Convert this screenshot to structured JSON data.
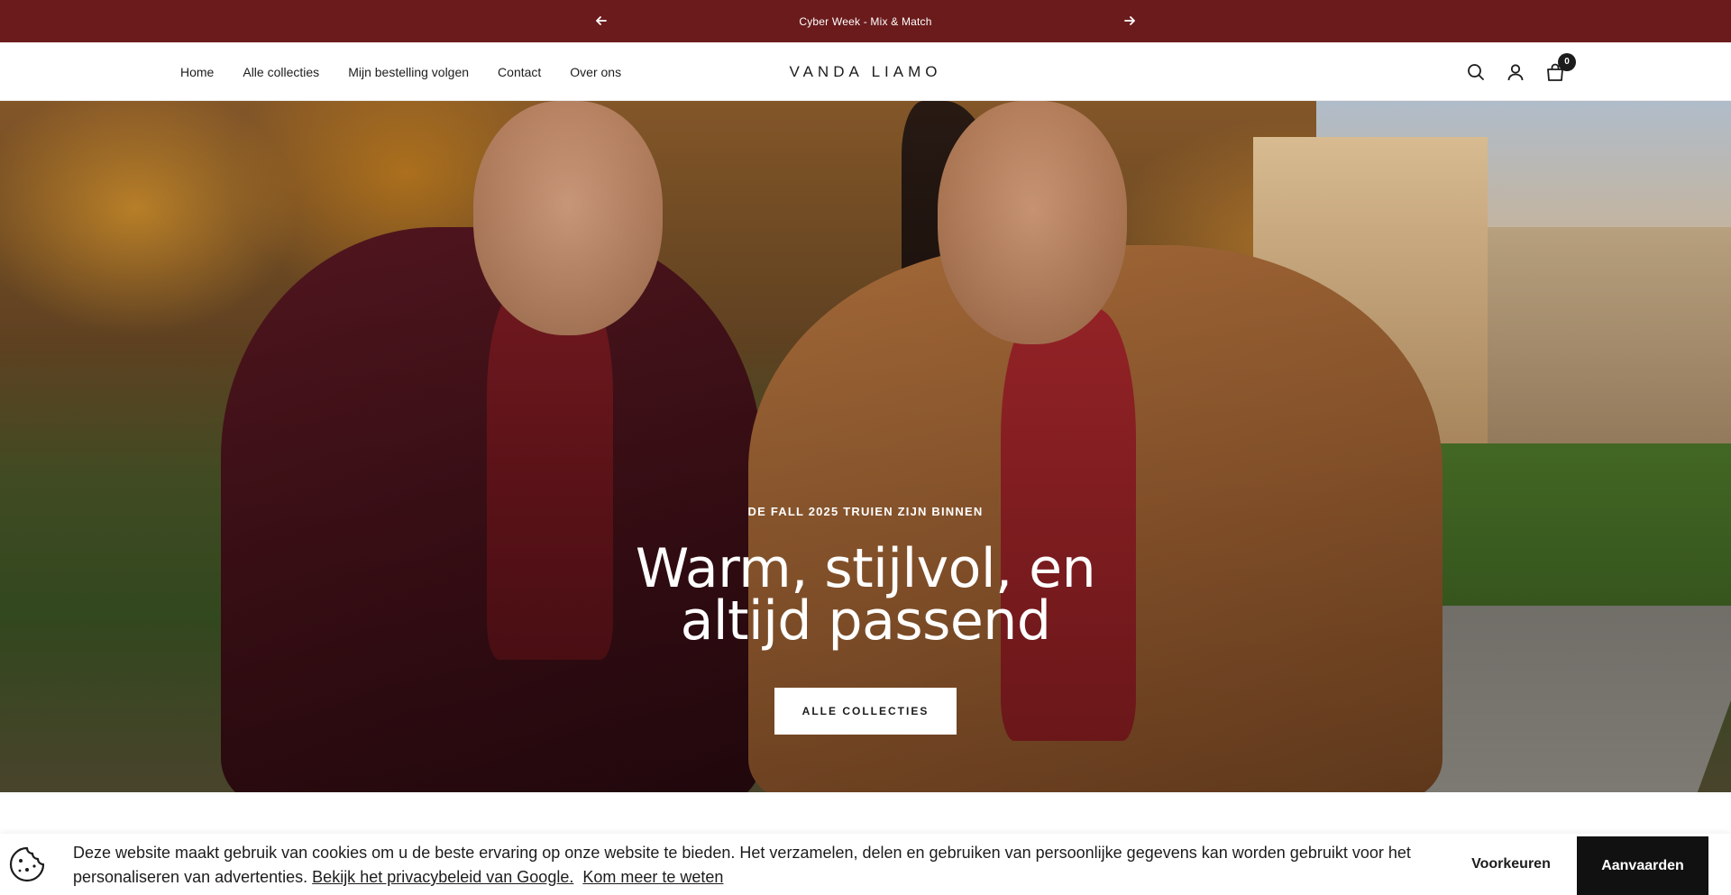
{
  "announcement": {
    "text": "Cyber Week - Mix & Match",
    "prev_icon": "arrow-left-icon",
    "next_icon": "arrow-right-icon"
  },
  "header": {
    "logo": "VANDA LIAMO",
    "nav": [
      {
        "label": "Home"
      },
      {
        "label": "Alle collecties"
      },
      {
        "label": "Mijn bestelling volgen"
      },
      {
        "label": "Contact"
      },
      {
        "label": "Over ons"
      }
    ],
    "icons": [
      "search-icon",
      "account-icon",
      "cart-icon"
    ],
    "cart_count": "0"
  },
  "hero": {
    "subheading": "DE FALL 2025 TRUIEN ZIJN BINNEN",
    "headline": "Warm, stijlvol, en altijd passend",
    "cta": "ALLE COLLECTIES"
  },
  "cookie": {
    "text": "Deze website maakt gebruik van cookies om u de beste ervaring op onze website te bieden. Het verzamelen, delen en gebruiken van persoonlijke gegevens kan worden gebruikt voor het personaliseren van advertenties.",
    "privacy_link": "Bekijk het privacybeleid van Google.",
    "learn_more_link": "Kom meer te weten",
    "preferences_button": "Voorkeuren",
    "accept_button": "Aanvaarden"
  },
  "colors": {
    "announcement_bg": "#6b1b1c",
    "accent_dark": "#111111"
  }
}
